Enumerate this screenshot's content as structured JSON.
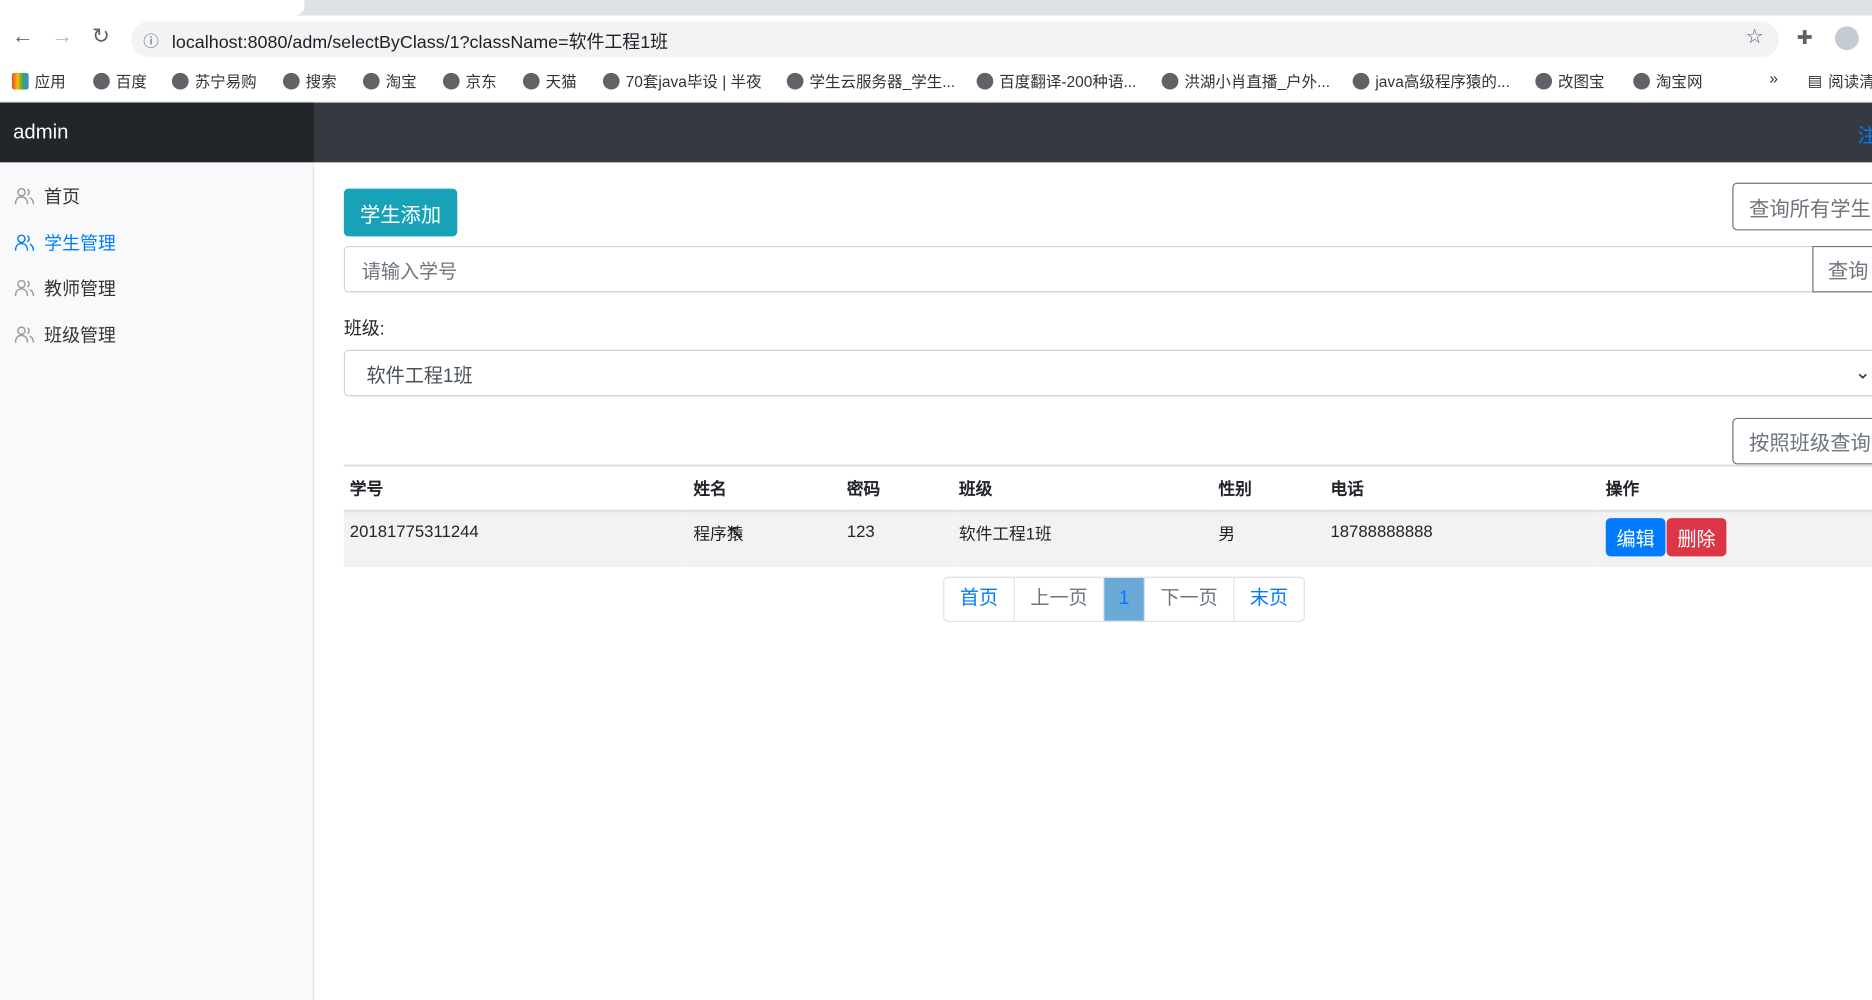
{
  "browser": {
    "url": "localhost:8080/adm/selectByClass/1?className=软件工程1班",
    "bookmarks": [
      "应用",
      "百度",
      "苏宁易购",
      "搜索",
      "淘宝",
      "京东",
      "天猫",
      "70套java毕设 | 半夜",
      "学生云服务器_学生...",
      "百度翻译-200种语...",
      "洪湖小肖直播_户外...",
      "java高级程序猿的...",
      "改图宝",
      "淘宝网"
    ],
    "more": "»",
    "reading_list": "阅读清"
  },
  "navbar": {
    "brand": "admin",
    "logout": "注"
  },
  "sidebar": {
    "items": [
      {
        "label": "首页"
      },
      {
        "label": "学生管理",
        "active": true
      },
      {
        "label": "教师管理"
      },
      {
        "label": "班级管理"
      }
    ]
  },
  "main": {
    "add_button": "学生添加",
    "query_all_button": "查询所有学生",
    "search_placeholder": "请输入学号",
    "search_button": "查询",
    "class_label": "班级:",
    "class_selected": "软件工程1班",
    "class_query_button": "按照班级查询"
  },
  "table": {
    "headers": [
      "学号",
      "姓名",
      "密码",
      "班级",
      "性别",
      "电话",
      "操作"
    ],
    "rows": [
      [
        "20181775311244",
        "程序猿",
        "123",
        "软件工程1班",
        "男",
        "18788888888"
      ]
    ],
    "edit": "编辑",
    "delete": "删除"
  },
  "pagination": {
    "first": "首页",
    "prev": "上一页",
    "current": "1",
    "next": "下一页",
    "last": "末页"
  },
  "colors": {
    "accent": "#007bff",
    "info": "#17a2b8",
    "danger": "#dc3545",
    "navbar": "#343a40"
  }
}
